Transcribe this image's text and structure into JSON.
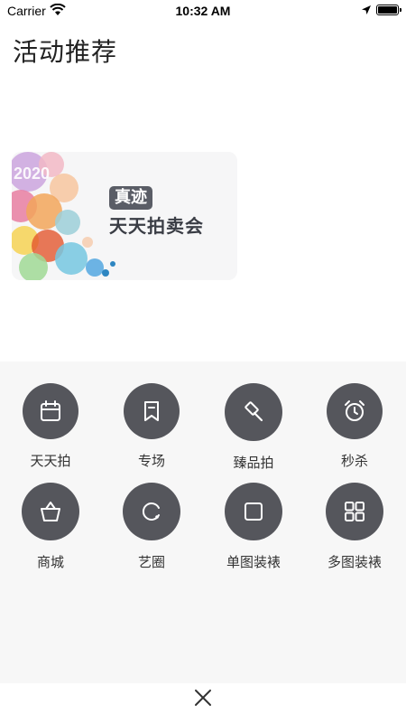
{
  "status_bar": {
    "carrier": "Carrier",
    "time": "10:32 AM"
  },
  "page": {
    "title": "活动推荐"
  },
  "banner": {
    "year": "2020",
    "badge": "真迹",
    "subtitle": "天天拍卖会"
  },
  "menu": {
    "items": [
      {
        "label": "天天拍",
        "icon": "calendar-icon"
      },
      {
        "label": "专场",
        "icon": "bookmark-icon"
      },
      {
        "label": "臻品拍",
        "icon": "gavel-icon"
      },
      {
        "label": "秒杀",
        "icon": "alarm-clock-icon"
      },
      {
        "label": "商城",
        "icon": "basket-icon"
      },
      {
        "label": "艺圈",
        "icon": "circle-icon"
      },
      {
        "label": "单图装裱",
        "icon": "square-icon"
      },
      {
        "label": "多图装裱",
        "icon": "grid-icon"
      }
    ]
  },
  "colors": {
    "icon_circle": "#55565c",
    "sheet_background": "#f7f7f7",
    "badge_background": "#5a5d66"
  }
}
